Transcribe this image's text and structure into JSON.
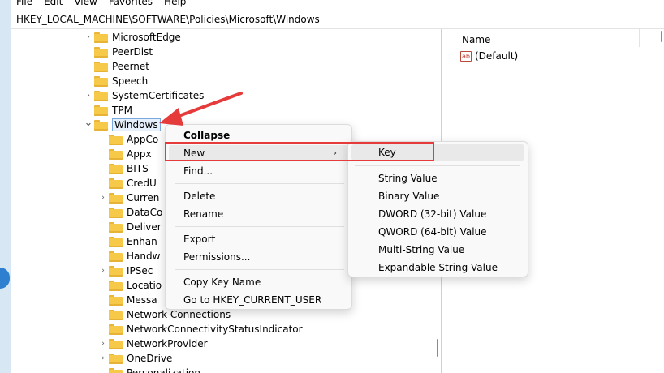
{
  "menubar": {
    "items": [
      "File",
      "Edit",
      "View",
      "Favorites",
      "Help"
    ]
  },
  "address": {
    "path": "HKEY_LOCAL_MACHINE\\SOFTWARE\\Policies\\Microsoft\\Windows"
  },
  "tree": {
    "items": [
      {
        "label": "MicrosoftEdge",
        "expander": true
      },
      {
        "label": "PeerDist",
        "expander": false
      },
      {
        "label": "Peernet",
        "expander": false
      },
      {
        "label": "Speech",
        "expander": false
      },
      {
        "label": "SystemCertificates",
        "expander": true
      },
      {
        "label": "TPM",
        "expander": false
      },
      {
        "label": "Windows",
        "expander": true,
        "expanded": true,
        "selected": true
      }
    ],
    "children": [
      {
        "label": "AppCo",
        "expander": false
      },
      {
        "label": "Appx",
        "expander": false
      },
      {
        "label": "BITS",
        "expander": false
      },
      {
        "label": "CredU",
        "expander": false
      },
      {
        "label": "Curren",
        "expander": true
      },
      {
        "label": "DataCo",
        "expander": false
      },
      {
        "label": "Deliver",
        "expander": false
      },
      {
        "label": "Enhan",
        "expander": false
      },
      {
        "label": "Handw",
        "expander": false
      },
      {
        "label": "IPSec",
        "expander": true
      },
      {
        "label": "Locatio",
        "expander": false
      },
      {
        "label": "Messa",
        "expander": false
      },
      {
        "label": "Network Connections",
        "expander": false
      },
      {
        "label": "NetworkConnectivityStatusIndicator",
        "expander": false
      },
      {
        "label": "NetworkProvider",
        "expander": true
      },
      {
        "label": "OneDrive",
        "expander": true
      },
      {
        "label": "Personalization",
        "expander": false
      }
    ]
  },
  "values": {
    "column_name": "Name",
    "rows": [
      {
        "icon": "string-value-icon",
        "name": "(Default)"
      }
    ]
  },
  "context_menu": {
    "collapse": "Collapse",
    "new": "New",
    "find": "Find...",
    "delete": "Delete",
    "rename": "Rename",
    "export": "Export",
    "permissions": "Permissions...",
    "copy_key_name": "Copy Key Name",
    "goto": "Go to HKEY_CURRENT_USER",
    "new_arrow": "›"
  },
  "submenu": {
    "key": "Key",
    "string_value": "String Value",
    "binary_value": "Binary Value",
    "dword": "DWORD (32-bit) Value",
    "qword": "QWORD (64-bit) Value",
    "multi_string": "Multi-String Value",
    "expandable_string": "Expandable String Value"
  },
  "colors": {
    "annotation_red": "#e53b3b",
    "folder_yellow": "#f7c948",
    "selection_blue": "#7aa8e0"
  }
}
